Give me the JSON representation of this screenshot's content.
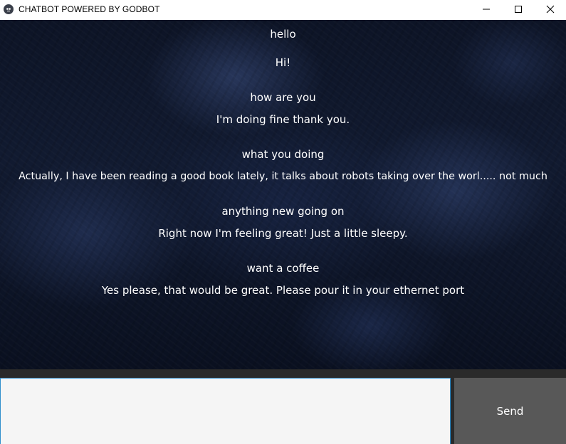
{
  "window": {
    "title": "CHATBOT POWERED BY GODBOT",
    "icon": "godot-icon",
    "controls": [
      "minimize-icon",
      "maximize-icon",
      "close-icon"
    ]
  },
  "colors": {
    "chat_text": "#ffffff",
    "chat_background": "#0d1426",
    "input_background": "#f5f5f5",
    "input_border": "#2f8fcc",
    "send_button_background": "#585858",
    "bottom_bar": "#2a2a2a"
  },
  "chat": {
    "messages": [
      {
        "speaker": "user",
        "text": "hello"
      },
      {
        "speaker": "bot",
        "text": "Hi!"
      },
      {
        "speaker": "user",
        "text": "how are you"
      },
      {
        "speaker": "bot",
        "text": "I'm doing fine thank you."
      },
      {
        "speaker": "user",
        "text": "what you doing"
      },
      {
        "speaker": "bot",
        "text": "Actually, I have been reading a good book lately, it talks about robots taking over the worl..... not much"
      },
      {
        "speaker": "user",
        "text": "anything new going on"
      },
      {
        "speaker": "bot",
        "text": "Right now I'm feeling great! Just a little sleepy."
      },
      {
        "speaker": "user",
        "text": "want a coffee"
      },
      {
        "speaker": "bot",
        "text": "Yes please, that would be great. Please pour it in your ethernet port"
      }
    ]
  },
  "composer": {
    "input_value": "",
    "send_label": "Send"
  }
}
